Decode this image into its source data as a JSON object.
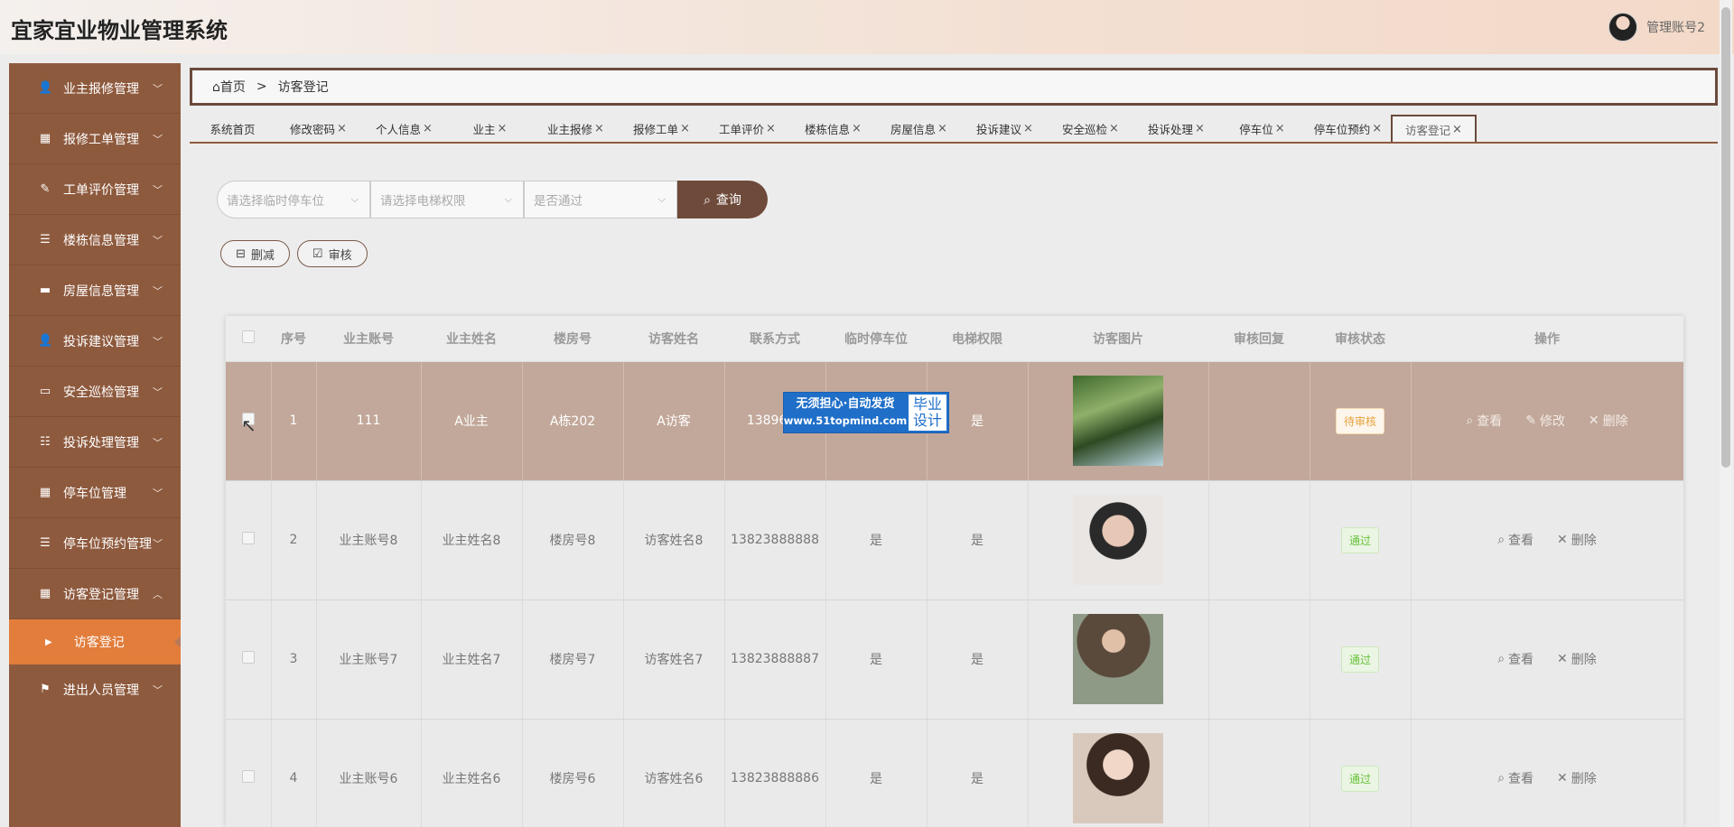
{
  "header": {
    "title": "宜家宜业物业管理系统",
    "username": "管理账号2"
  },
  "sidebar": {
    "items": [
      {
        "label": "业主报修管理",
        "icon": "user-icon",
        "glyph": "👤"
      },
      {
        "label": "报修工单管理",
        "icon": "grid-icon",
        "glyph": "▦"
      },
      {
        "label": "工单评价管理",
        "icon": "thumb-icon",
        "glyph": "✎"
      },
      {
        "label": "楼栋信息管理",
        "icon": "list-icon",
        "glyph": "☰"
      },
      {
        "label": "房屋信息管理",
        "icon": "ticket-icon",
        "glyph": "▬"
      },
      {
        "label": "投诉建议管理",
        "icon": "user-icon",
        "glyph": "👤"
      },
      {
        "label": "安全巡检管理",
        "icon": "monitor-icon",
        "glyph": "▭"
      },
      {
        "label": "投诉处理管理",
        "icon": "sliders-icon",
        "glyph": "☷"
      },
      {
        "label": "停车位管理",
        "icon": "grid-icon",
        "glyph": "▦"
      },
      {
        "label": "停车位预约管理",
        "icon": "list-icon",
        "glyph": "☰"
      },
      {
        "label": "访客登记管理",
        "icon": "grid-icon",
        "glyph": "▦"
      }
    ],
    "active_sub": "访客登记",
    "last_item": {
      "label": "进出人员管理",
      "icon": "flag-icon",
      "glyph": "⚑"
    }
  },
  "breadcrumb": {
    "home": "首页",
    "sep": ">",
    "current": "访客登记"
  },
  "tabs": [
    {
      "label": "系统首页",
      "closable": false
    },
    {
      "label": "修改密码",
      "closable": true
    },
    {
      "label": "个人信息",
      "closable": true
    },
    {
      "label": "业主",
      "closable": true
    },
    {
      "label": "业主报修",
      "closable": true
    },
    {
      "label": "报修工单",
      "closable": true
    },
    {
      "label": "工单评价",
      "closable": true
    },
    {
      "label": "楼栋信息",
      "closable": true
    },
    {
      "label": "房屋信息",
      "closable": true
    },
    {
      "label": "投诉建议",
      "closable": true
    },
    {
      "label": "安全巡检",
      "closable": true
    },
    {
      "label": "投诉处理",
      "closable": true
    },
    {
      "label": "停车位",
      "closable": true
    },
    {
      "label": "停车位预约",
      "closable": true
    },
    {
      "label": "访客登记",
      "closable": true,
      "active": true
    }
  ],
  "filters": {
    "parking_placeholder": "请选择临时停车位",
    "elevator_placeholder": "请选择电梯权限",
    "approved_placeholder": "是否通过",
    "query_label": "查询"
  },
  "actions": {
    "delete_label": "删减",
    "review_label": "审核"
  },
  "table": {
    "headers": [
      "序号",
      "业主账号",
      "业主姓名",
      "楼房号",
      "访客姓名",
      "联系方式",
      "临时停车位",
      "电梯权限",
      "访客图片",
      "审核回复",
      "审核状态",
      "操作"
    ],
    "rows": [
      {
        "no": "1",
        "account": "111",
        "owner": "A业主",
        "room": "A栋202",
        "visitor": "A访客",
        "phone": "1389696",
        "parking": "",
        "elevator": "是",
        "reply": "",
        "status": "待审核",
        "status_type": "pending",
        "can_edit": true
      },
      {
        "no": "2",
        "account": "业主账号8",
        "owner": "业主姓名8",
        "room": "楼房号8",
        "visitor": "访客姓名8",
        "phone": "13823888888",
        "parking": "是",
        "elevator": "是",
        "reply": "",
        "status": "通过",
        "status_type": "ok",
        "can_edit": false
      },
      {
        "no": "3",
        "account": "业主账号7",
        "owner": "业主姓名7",
        "room": "楼房号7",
        "visitor": "访客姓名7",
        "phone": "13823888887",
        "parking": "是",
        "elevator": "是",
        "reply": "",
        "status": "通过",
        "status_type": "ok",
        "can_edit": false
      },
      {
        "no": "4",
        "account": "业主账号6",
        "owner": "业主姓名6",
        "room": "楼房号6",
        "visitor": "访客姓名6",
        "phone": "13823888886",
        "parking": "是",
        "elevator": "是",
        "reply": "",
        "status": "通过",
        "status_type": "ok",
        "can_edit": false
      }
    ],
    "op_view": "查看",
    "op_edit": "修改",
    "op_delete": "删除"
  },
  "watermark": {
    "line1": "无须担心·自动发货",
    "url": "www.51topmind.com",
    "right1": "毕业",
    "right2": "设计"
  },
  "colors": {
    "sidebar": "#8e5a3e",
    "active_sub": "#e27d3c",
    "selected_row": "#c2a89a",
    "primary": "#6e4a3a"
  }
}
